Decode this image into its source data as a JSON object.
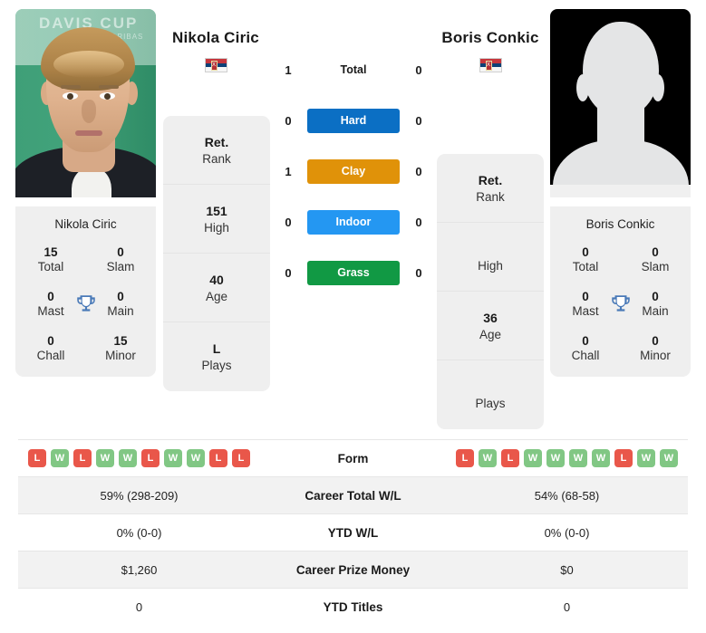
{
  "players": {
    "left": {
      "name": "Nikola Ciric",
      "card_name": "Nikola Ciric",
      "country": "Serbia",
      "photo_type": "press-photo",
      "rank": "Ret.",
      "rank_label": "Rank",
      "high": "151",
      "high_label": "High",
      "age": "40",
      "age_label": "Age",
      "plays": "L",
      "plays_label": "Plays",
      "titles": {
        "total": "15",
        "total_label": "Total",
        "slam": "0",
        "slam_label": "Slam",
        "mast": "0",
        "mast_label": "Mast",
        "main": "0",
        "main_label": "Main",
        "chall": "0",
        "chall_label": "Chall",
        "minor": "15",
        "minor_label": "Minor"
      },
      "form": [
        "L",
        "W",
        "L",
        "W",
        "W",
        "L",
        "W",
        "W",
        "L",
        "L"
      ],
      "career_total_wl": "59% (298-209)",
      "ytd_wl": "0% (0-0)",
      "career_prize_money": "$1,260",
      "ytd_titles": "0"
    },
    "right": {
      "name": "Boris Conkic",
      "card_name": "Boris Conkic",
      "country": "Serbia",
      "photo_type": "silhouette-placeholder",
      "rank": "Ret.",
      "rank_label": "Rank",
      "high": "",
      "high_label": "High",
      "age": "36",
      "age_label": "Age",
      "plays": "",
      "plays_label": "Plays",
      "titles": {
        "total": "0",
        "total_label": "Total",
        "slam": "0",
        "slam_label": "Slam",
        "mast": "0",
        "mast_label": "Mast",
        "main": "0",
        "main_label": "Main",
        "chall": "0",
        "chall_label": "Chall",
        "minor": "0",
        "minor_label": "Minor"
      },
      "form": [
        "L",
        "W",
        "L",
        "W",
        "W",
        "W",
        "W",
        "L",
        "W",
        "W"
      ],
      "career_total_wl": "54% (68-58)",
      "ytd_wl": "0% (0-0)",
      "career_prize_money": "$0",
      "ytd_titles": "0"
    }
  },
  "h2h": {
    "rows": [
      {
        "label": "Total",
        "left": "1",
        "right": "0",
        "color": ""
      },
      {
        "label": "Hard",
        "left": "0",
        "right": "0",
        "color": "#0b6fc4"
      },
      {
        "label": "Clay",
        "left": "1",
        "right": "0",
        "color": "#e09209"
      },
      {
        "label": "Indoor",
        "left": "0",
        "right": "0",
        "color": "#2497f2"
      },
      {
        "label": "Grass",
        "left": "0",
        "right": "0",
        "color": "#119944"
      }
    ]
  },
  "table": {
    "rows": [
      {
        "label": "Form"
      },
      {
        "label": "Career Total W/L"
      },
      {
        "label": "YTD W/L"
      },
      {
        "label": "Career Prize Money"
      },
      {
        "label": "YTD Titles"
      }
    ]
  },
  "colors": {
    "win": "#81c784",
    "loss": "#e9574a",
    "panel": "#efefef",
    "row_shade": "#f2f2f2",
    "trophy": "#4a7ab8"
  }
}
